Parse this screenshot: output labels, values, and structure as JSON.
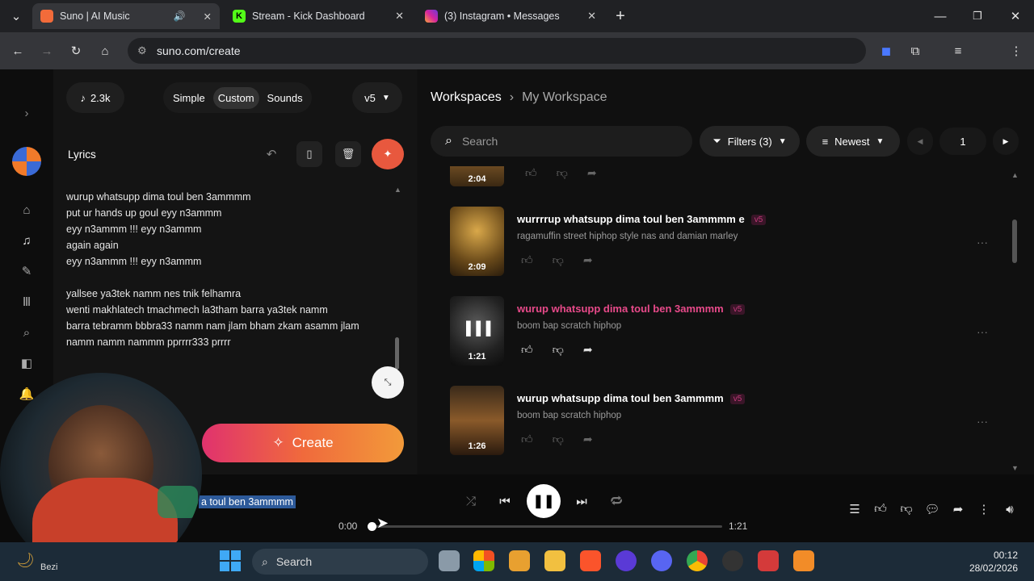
{
  "browser": {
    "tabs": [
      {
        "title": "Suno | AI Music",
        "active": true,
        "favicon_color": "#f26b3a"
      },
      {
        "title": "Stream - Kick Dashboard",
        "active": false,
        "favicon_color": "#53fc18"
      },
      {
        "title": "(3) Instagram • Messages",
        "active": false,
        "favicon_color": "#d6249f"
      }
    ],
    "url": "suno.com/create"
  },
  "composer": {
    "credits": "2.3k",
    "modes": [
      "Simple",
      "Custom",
      "Sounds"
    ],
    "active_mode": "Custom",
    "model": "v5",
    "lyrics_label": "Lyrics",
    "lyrics_text": "wurup whatsupp dima toul ben 3ammmm\nput ur hands up goul eyy n3ammm\neyy n3ammm  !!! eyy n3ammm\nagain again\neyy n3ammm  !!! eyy n3ammm\n\nyallsee ya3tek namm nes tnik felhamra\nwenti makhlatech tmachmech la3tham barra ya3tek namm\nbarra tebramm bbbra33 namm nam jlam bham zkam asamm jlam\nnamm namm nammm pprrrr333 prrrr",
    "create_label": "Create"
  },
  "workspace": {
    "breadcrumb_root": "Workspaces",
    "breadcrumb_current": "My Workspace",
    "search_placeholder": "Search",
    "filters_label": "Filters (3)",
    "sort_label": "Newest",
    "page": "1",
    "partial_song_duration": "2:04",
    "songs": [
      {
        "title": "wurrrrup whatsupp dima toul ben 3ammmm e",
        "badge": "v5",
        "style": "ragamuffin street hiphop style nas and damian marley",
        "duration": "2:09",
        "playing": false
      },
      {
        "title": "wurup whatsupp dima toul ben 3ammmm",
        "badge": "v5",
        "style": "boom bap scratch hiphop",
        "duration": "1:21",
        "playing": true
      },
      {
        "title": "wurup whatsupp dima toul ben 3ammmm",
        "badge": "v5",
        "style": "boom bap scratch hiphop",
        "duration": "1:26",
        "playing": false
      }
    ]
  },
  "player": {
    "now_playing": "a toul ben 3ammmm",
    "current_time": "0:00",
    "total_time": "1:21",
    "progress": 0.01
  },
  "taskbar": {
    "search_placeholder": "Search",
    "weather_text": "Bezi",
    "time": "00:12",
    "date": "28/02/2026"
  },
  "colors": {
    "accent_pink": "#e0326e",
    "accent_orange": "#f06a3c",
    "active_title": "#e84a8a"
  }
}
